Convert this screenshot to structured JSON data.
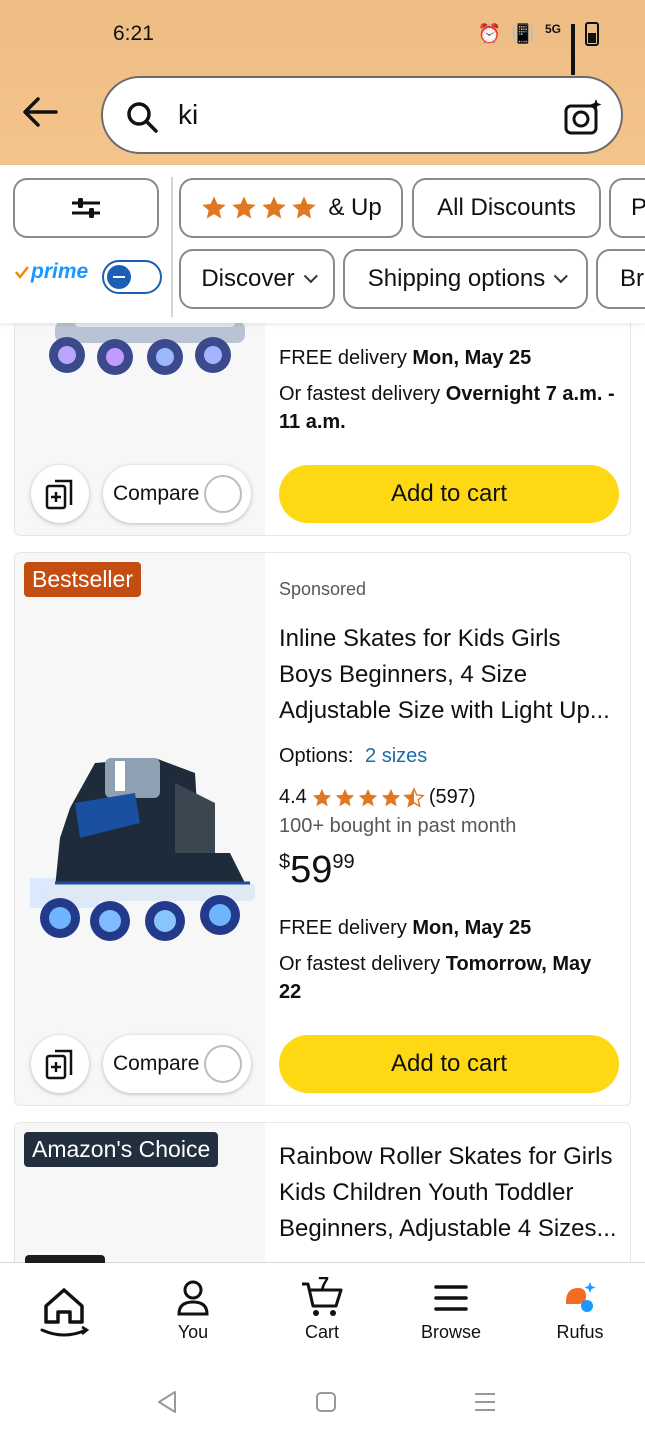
{
  "status_bar": {
    "time": "6:21",
    "network": "5G"
  },
  "search": {
    "query": "ki"
  },
  "filters": {
    "row1": [
      {
        "label": "& Up"
      },
      {
        "label": "All Discounts"
      },
      {
        "label": "P"
      }
    ],
    "row2": [
      {
        "label": "Discover"
      },
      {
        "label": "Shipping options"
      },
      {
        "label": "Br"
      }
    ],
    "prime_label": "prime"
  },
  "products": [
    {
      "delivery_free_prefix": "FREE delivery ",
      "delivery_free_date": "Mon, May 25",
      "delivery_fast_prefix": "Or fastest delivery ",
      "delivery_fast_date": "Overnight 7 a.m. - 11 a.m.",
      "compare_label": "Compare",
      "add_to_cart": "Add to cart"
    },
    {
      "badge": "Bestseller",
      "sponsored": "Sponsored",
      "title": "Inline Skates for Kids Girls Boys Beginners, 4 Size Adjustable Size with Light Up...",
      "options_label": "Options:",
      "options_value": "2 sizes",
      "rating": "4.4",
      "rating_value": 4.4,
      "reviews": "(597)",
      "bought": "100+ bought in past month",
      "price_symbol": "$",
      "price_whole": "59",
      "price_fraction": "99",
      "delivery_free_prefix": "FREE delivery ",
      "delivery_free_date": "Mon, May 25",
      "delivery_fast_prefix": "Or fastest delivery ",
      "delivery_fast_date": "Tomorrow, May 22",
      "compare_label": "Compare",
      "add_to_cart": "Add to cart"
    },
    {
      "badge": "Amazon's Choice",
      "title": "Rainbow Roller Skates for Girls Kids Children Youth Toddler Beginners, Adjustable 4 Sizes..."
    }
  ],
  "bottom_nav": [
    {
      "label": ""
    },
    {
      "label": "You"
    },
    {
      "label": "Cart",
      "count": "7"
    },
    {
      "label": "Browse"
    },
    {
      "label": "Rufus"
    }
  ],
  "colors": {
    "header_bg": "#f3c48c",
    "add_to_cart": "#ffd814",
    "bestseller_badge": "#c44d12",
    "choice_badge": "#232f3e",
    "star": "#de7921",
    "link": "#1a6fa8",
    "prime_blue": "#1a98ff"
  }
}
